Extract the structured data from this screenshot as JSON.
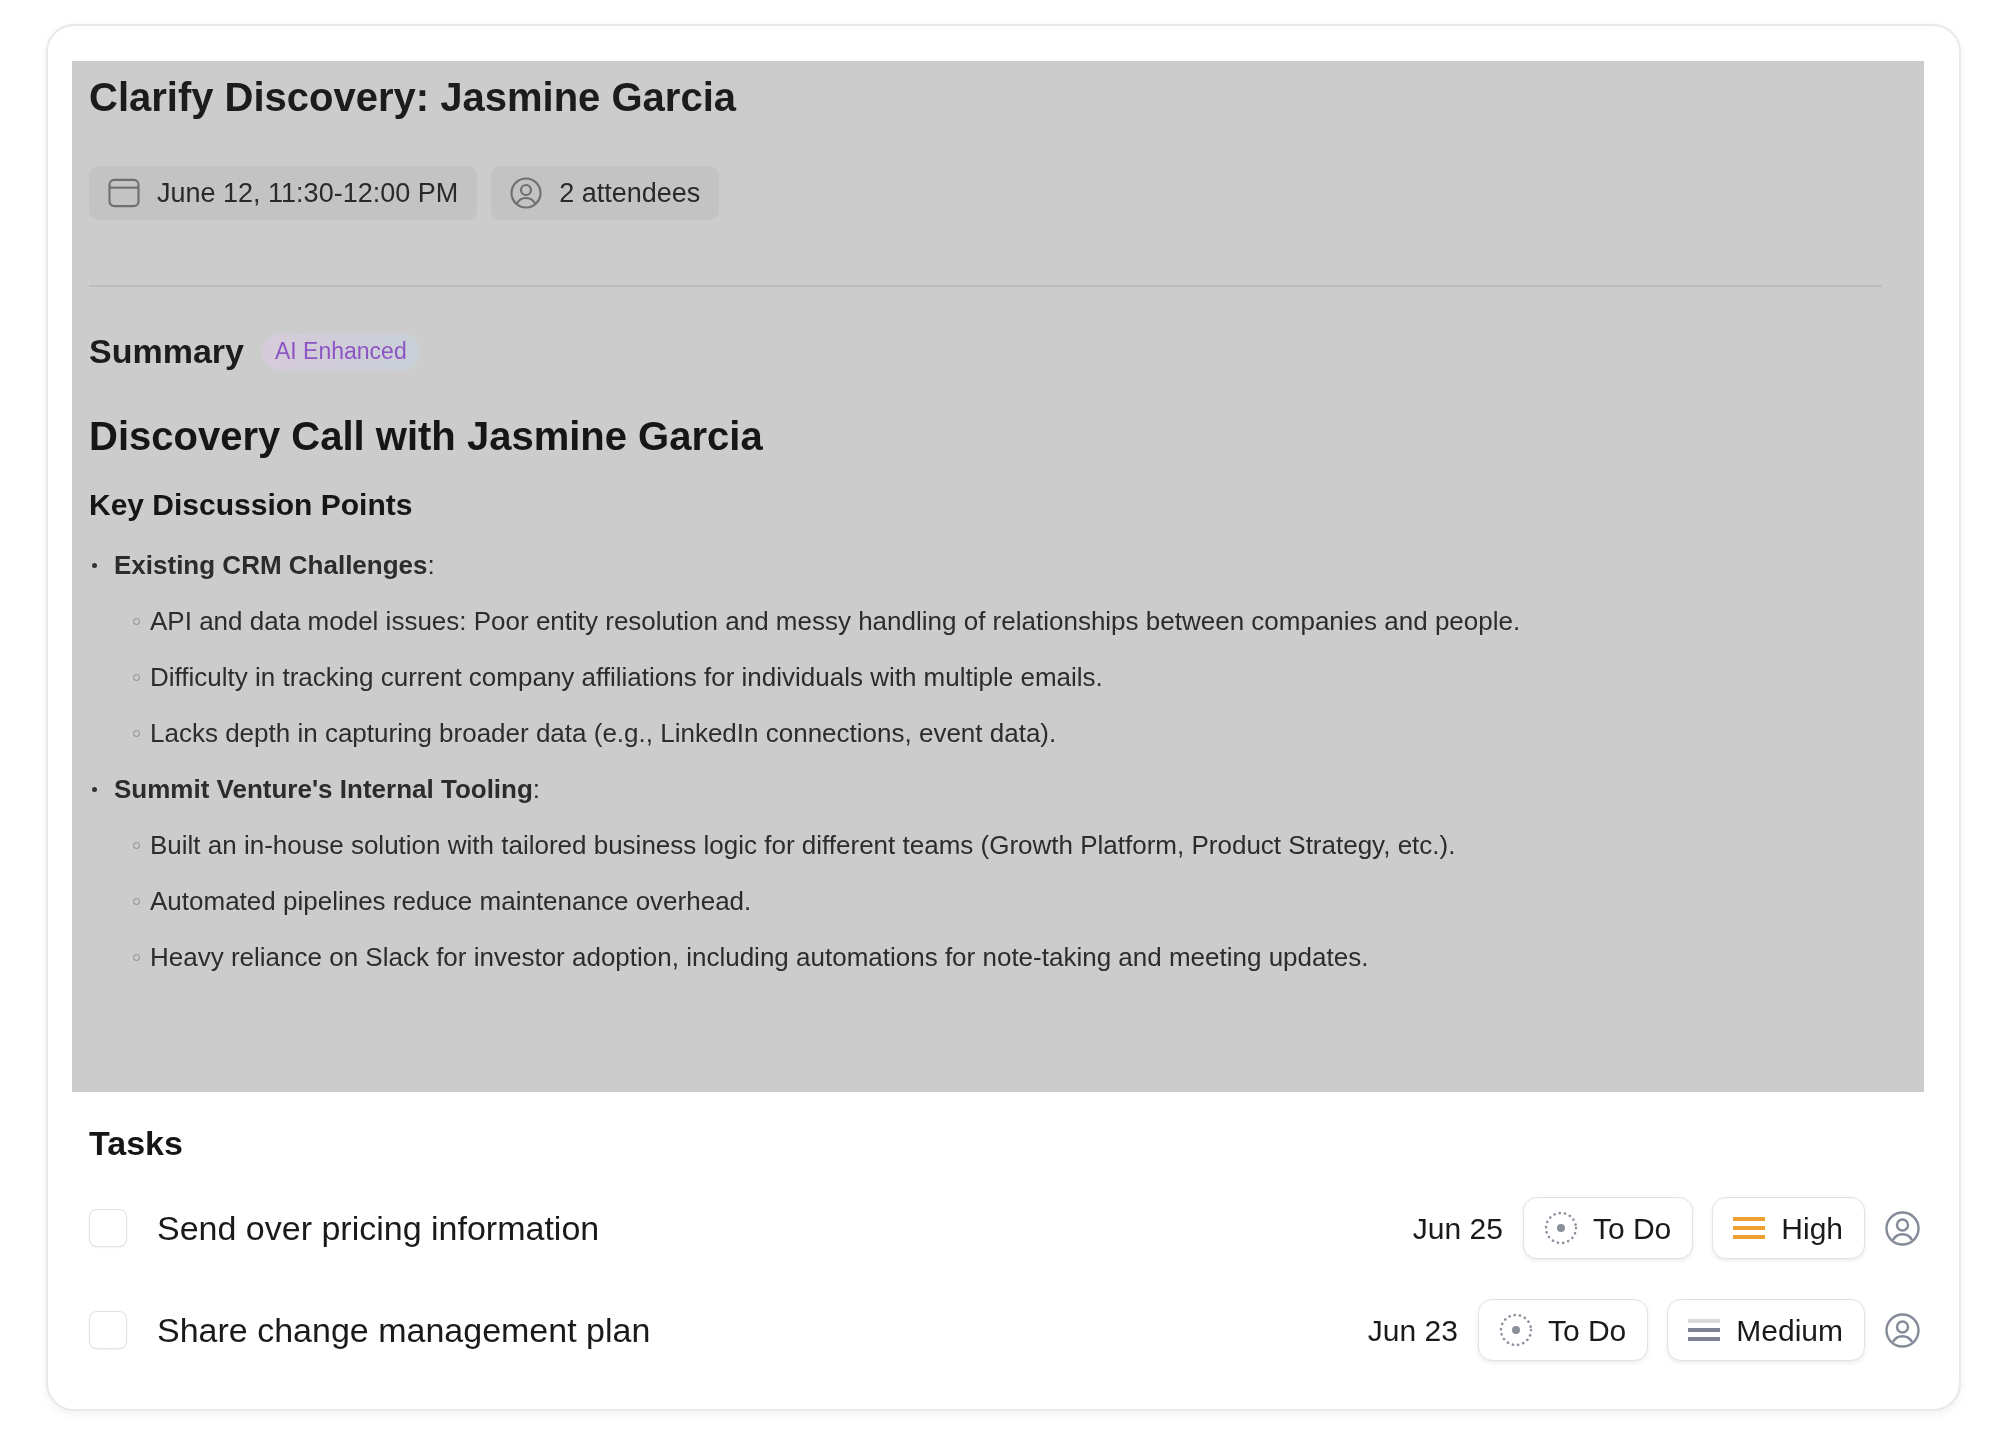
{
  "title": "Clarify Discovery: Jasmine Garcia",
  "meta": [
    {
      "kind": "date",
      "text": "June 12, 11:30-12:00 PM"
    },
    {
      "kind": "attendees",
      "text": "2 attendees"
    }
  ],
  "summary": {
    "heading": "Summary",
    "badge": "AI Enhanced",
    "title": "Discovery Call with Jasmine Garcia",
    "subtitle": "Key Discussion Points",
    "points": [
      {
        "text": "**Existing CRM Challenges**:",
        "children": [
          {
            "text": "API and data model issues: Poor entity resolution and messy handling of relationships between companies and people."
          },
          {
            "text": "Difficulty in tracking current company affiliations for individuals with multiple emails."
          },
          {
            "text": "Lacks depth in capturing broader data (e.g., LinkedIn connections, event data)."
          }
        ]
      },
      {
        "text": "**Summit Venture's Internal Tooling**:",
        "children": [
          {
            "text": "Built an in-house solution with tailored business logic for different teams (Growth Platform, Product Strategy, etc.)."
          },
          {
            "text": "Automated pipelines reduce maintenance overhead."
          },
          {
            "text": "Heavy reliance on Slack for investor adoption, including automations for note-taking and meeting updates."
          }
        ]
      }
    ]
  },
  "tasks": {
    "heading": "Tasks",
    "items": [
      {
        "title": "Send over pricing information",
        "checked": false,
        "due": "Jun 25",
        "status": "To Do",
        "priority": {
          "kind": "high",
          "label": "High"
        }
      },
      {
        "title": "Share change management plan",
        "checked": false,
        "due": "Jun 23",
        "status": "To Do",
        "priority": {
          "kind": "medium",
          "label": "Medium"
        }
      }
    ]
  }
}
